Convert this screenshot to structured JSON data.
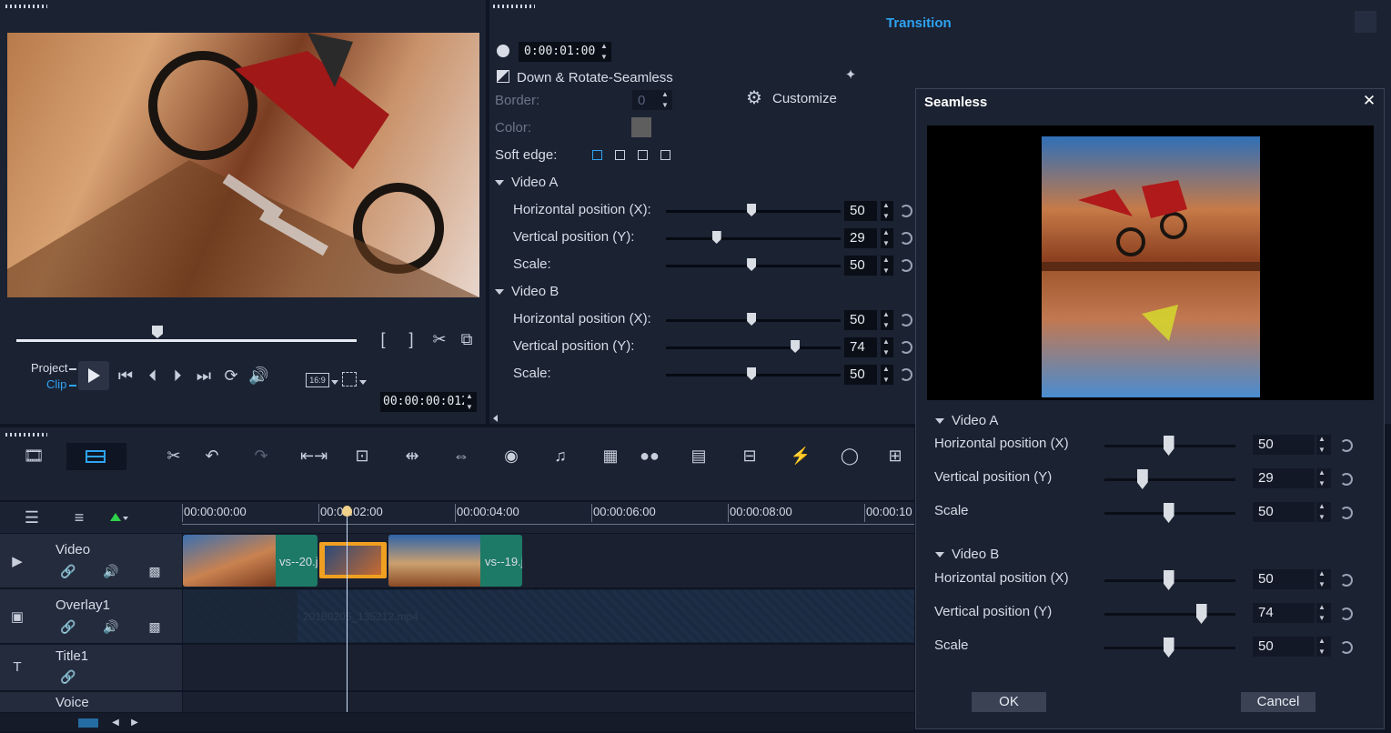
{
  "transition": {
    "header": "Transition",
    "duration": "0:00:01:00",
    "name": "Down & Rotate-Seamless",
    "border_label": "Border:",
    "border_value": "0",
    "color_label": "Color:",
    "softedge_label": "Soft edge:",
    "customize_label": "Customize",
    "videoA": {
      "label": "Video A",
      "rows": [
        {
          "label": "Horizontal position (X):",
          "value": "50",
          "pct": 0.49
        },
        {
          "label": "Vertical position (Y):",
          "value": "29",
          "pct": 0.29
        },
        {
          "label": "Scale:",
          "value": "50",
          "pct": 0.49
        }
      ]
    },
    "videoB": {
      "label": "Video B",
      "rows": [
        {
          "label": "Horizontal position (X):",
          "value": "50",
          "pct": 0.49
        },
        {
          "label": "Vertical position (Y):",
          "value": "74",
          "pct": 0.74
        },
        {
          "label": "Scale:",
          "value": "50",
          "pct": 0.49
        }
      ]
    }
  },
  "player": {
    "project_label": "Project",
    "clip_label": "Clip",
    "aspect": "16:9",
    "timecode": "00:00:00:012"
  },
  "timeline": {
    "ruler": [
      "00:00:00:00",
      "00:00:02:00",
      "00:00:04:00",
      "00:00:06:00",
      "00:00:08:00",
      "00:00:10"
    ],
    "tracks": [
      {
        "name": "Video"
      },
      {
        "name": "Overlay1"
      },
      {
        "name": "Title1"
      },
      {
        "name": "Voice"
      }
    ],
    "clips": {
      "clip1_label": "vs--20.j",
      "clip2_label": "vs--19.j",
      "overlay_label": "20180205_135212.mp4"
    }
  },
  "dialog": {
    "title": "Seamless",
    "videoA": {
      "label": "Video A",
      "rows": [
        {
          "label": "Horizontal position (X)",
          "value": "50",
          "pct": 0.49
        },
        {
          "label": "Vertical position (Y)",
          "value": "29",
          "pct": 0.29
        },
        {
          "label": "Scale",
          "value": "50",
          "pct": 0.49
        }
      ]
    },
    "videoB": {
      "label": "Video B",
      "rows": [
        {
          "label": "Horizontal position (X)",
          "value": "50",
          "pct": 0.49
        },
        {
          "label": "Vertical position (Y)",
          "value": "74",
          "pct": 0.74
        },
        {
          "label": "Scale",
          "value": "50",
          "pct": 0.49
        }
      ]
    },
    "ok_label": "OK",
    "cancel_label": "Cancel"
  },
  "colors": {
    "accent": "#2ea3f2",
    "clip_green": "#1c7a66",
    "selected_clip": "#f0a020"
  }
}
